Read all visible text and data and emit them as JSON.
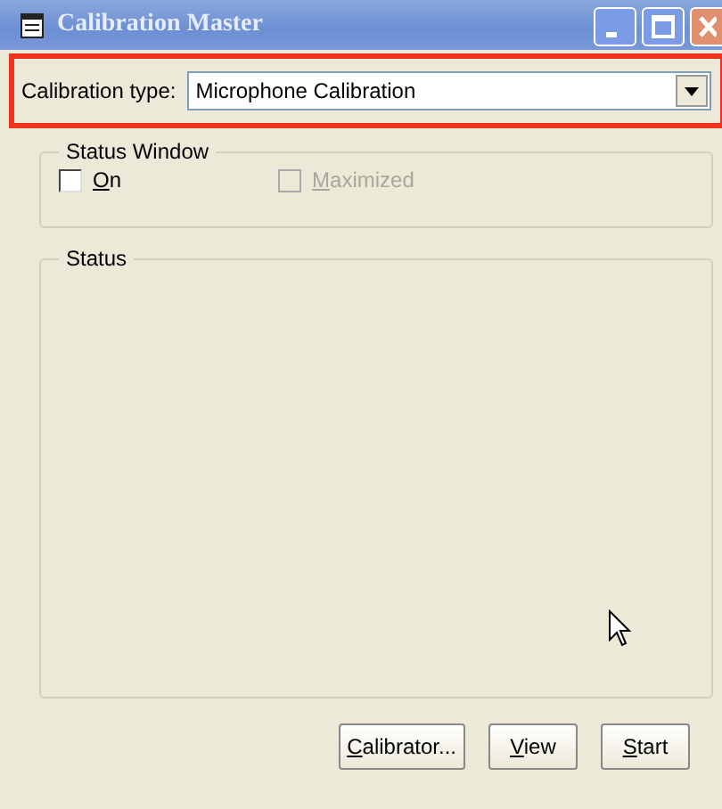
{
  "window": {
    "title": "Calibration Master"
  },
  "calibration_type": {
    "label": "Calibration type:",
    "value": "Microphone Calibration",
    "highlighted": true
  },
  "status_window": {
    "title": "Status Window",
    "checkboxes": [
      {
        "accel": "O",
        "rest": "n",
        "checked": false,
        "disabled": false
      },
      {
        "accel": "M",
        "rest": "aximized",
        "checked": false,
        "disabled": true
      }
    ]
  },
  "status": {
    "title": "Status"
  },
  "buttons": [
    {
      "accel": "C",
      "rest": "alibrator..."
    },
    {
      "accel": "V",
      "rest": "iew"
    },
    {
      "accel": "S",
      "rest": "tart"
    }
  ]
}
